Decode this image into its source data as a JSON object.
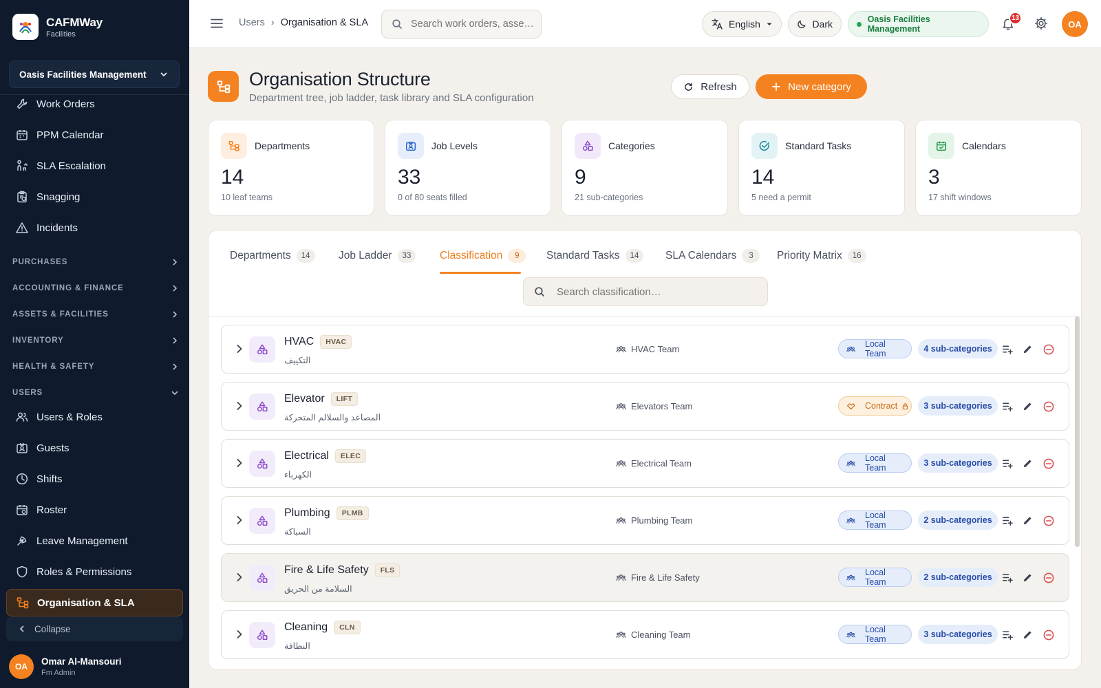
{
  "brand": {
    "title": "CAFMWay",
    "subtitle": "Facilities"
  },
  "org_selector": {
    "value": "Oasis Facilities Management"
  },
  "sidebar": {
    "top_items": [
      {
        "label": "Work Orders",
        "icon": "wrench-icon"
      },
      {
        "label": "PPM Calendar",
        "icon": "calendar-icon"
      },
      {
        "label": "SLA Escalation",
        "icon": "escalation-icon"
      },
      {
        "label": "Snagging",
        "icon": "clipboard-icon"
      },
      {
        "label": "Incidents",
        "icon": "warning-icon"
      }
    ],
    "sections": [
      {
        "label": "PURCHASES",
        "expanded": false
      },
      {
        "label": "ACCOUNTING & FINANCE",
        "expanded": false
      },
      {
        "label": "ASSETS & FACILITIES",
        "expanded": false
      },
      {
        "label": "INVENTORY",
        "expanded": false
      },
      {
        "label": "HEALTH & SAFETY",
        "expanded": false
      },
      {
        "label": "USERS",
        "expanded": true
      }
    ],
    "user_items": [
      {
        "label": "Users & Roles",
        "icon": "users-icon"
      },
      {
        "label": "Guests",
        "icon": "badge-icon"
      },
      {
        "label": "Shifts",
        "icon": "clock-icon"
      },
      {
        "label": "Roster",
        "icon": "roster-icon"
      },
      {
        "label": "Leave Management",
        "icon": "leave-icon"
      },
      {
        "label": "Roles & Permissions",
        "icon": "shield-icon"
      },
      {
        "label": "Organisation & SLA",
        "icon": "org-tree-icon",
        "active": true
      }
    ],
    "collapse_label": "Collapse",
    "user": {
      "initials": "OA",
      "name": "Omar Al-Mansouri",
      "role": "Fm Admin"
    }
  },
  "topbar": {
    "breadcrumb": [
      "Users",
      "Organisation & SLA"
    ],
    "search_placeholder": "Search work orders, asse…",
    "language": "English",
    "theme": "Dark",
    "org_status": "Oasis Facilities Management",
    "notifications": "13",
    "avatar_initials": "OA"
  },
  "page": {
    "title": "Organisation Structure",
    "subtitle": "Department tree, job ladder, task library and SLA configuration",
    "refresh_label": "Refresh",
    "new_label": "New category"
  },
  "stats": [
    {
      "label": "Departments",
      "value": "14",
      "hint": "10 leaf teams",
      "icon": "org-tree-icon",
      "color": "#f58220",
      "bg": "#fdeee0"
    },
    {
      "label": "Job Levels",
      "value": "33",
      "hint": "0 of 80 seats filled",
      "icon": "id-card-icon",
      "color": "#2a62c9",
      "bg": "#e6eefb"
    },
    {
      "label": "Categories",
      "value": "9",
      "hint": "21 sub-categories",
      "icon": "category-icon",
      "color": "#8a45c9",
      "bg": "#f1e9fa"
    },
    {
      "label": "Standard Tasks",
      "value": "14",
      "hint": "5 need a permit",
      "icon": "check-circle-icon",
      "color": "#1c8a9a",
      "bg": "#e3f3f5"
    },
    {
      "label": "Calendars",
      "value": "3",
      "hint": "17 shift windows",
      "icon": "calendar-check-icon",
      "color": "#1f9a4a",
      "bg": "#e4f4e8"
    }
  ],
  "tabs": [
    {
      "label": "Departments",
      "count": "14"
    },
    {
      "label": "Job Ladder",
      "count": "33"
    },
    {
      "label": "Classification",
      "count": "9",
      "active": true
    },
    {
      "label": "Standard Tasks",
      "count": "14"
    },
    {
      "label": "SLA Calendars",
      "count": "3"
    },
    {
      "label": "Priority Matrix",
      "count": "16"
    }
  ],
  "classification_search_placeholder": "Search classification…",
  "categories": [
    {
      "name": "HVAC",
      "code": "HVAC",
      "arabic": "التكييف",
      "team": "HVAC Team",
      "type": "Local Team",
      "sub": "4 sub-categories"
    },
    {
      "name": "Elevator",
      "code": "LIFT",
      "arabic": "المصاعد والسلالم المتحركة",
      "team": "Elevators Team",
      "type": "Contract",
      "sub": "3 sub-categories"
    },
    {
      "name": "Electrical",
      "code": "ELEC",
      "arabic": "الكهرباء",
      "team": "Electrical Team",
      "type": "Local Team",
      "sub": "3 sub-categories"
    },
    {
      "name": "Plumbing",
      "code": "PLMB",
      "arabic": "السباكة",
      "team": "Plumbing Team",
      "type": "Local Team",
      "sub": "2 sub-categories"
    },
    {
      "name": "Fire & Life Safety",
      "code": "FLS",
      "arabic": "السلامة من الحريق",
      "team": "Fire & Life Safety",
      "type": "Local Team",
      "sub": "2 sub-categories"
    },
    {
      "name": "Cleaning",
      "code": "CLN",
      "arabic": "النظافة",
      "team": "Cleaning Team",
      "type": "Local Team",
      "sub": "3 sub-categories"
    }
  ]
}
